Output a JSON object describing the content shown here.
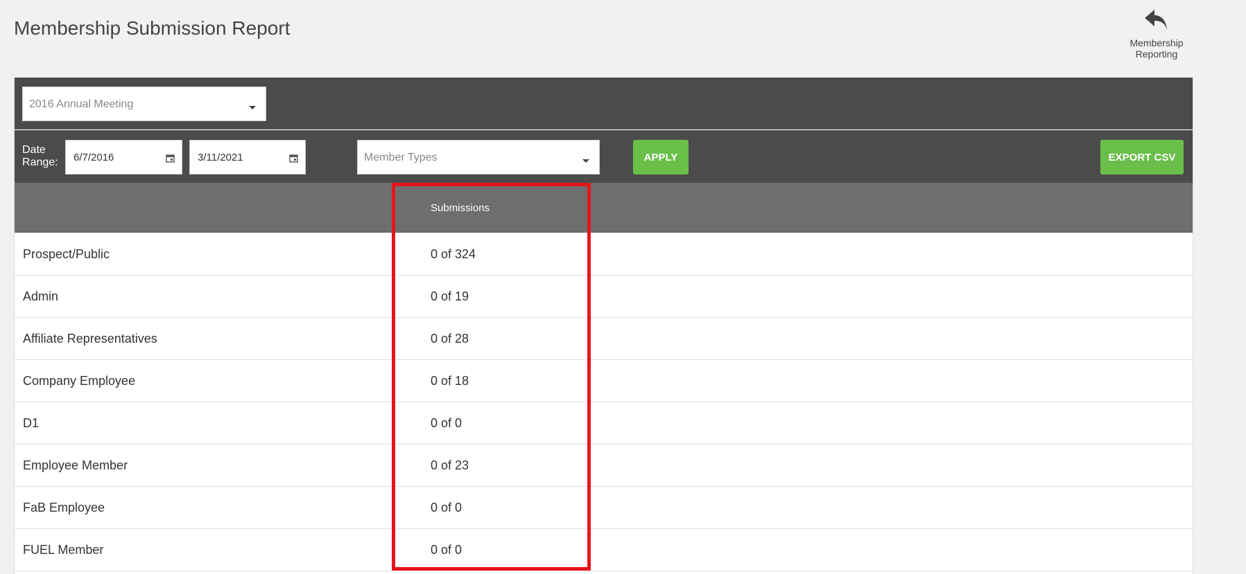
{
  "header": {
    "title": "Membership Submission Report",
    "back_label_line1": "Membership",
    "back_label_line2": "Reporting"
  },
  "filters": {
    "meeting": "2016 Annual Meeting",
    "date_range_label_line1": "Date",
    "date_range_label_line2": "Range:",
    "start_date": "6/7/2016",
    "end_date": "3/11/2021",
    "member_types_placeholder": "Member Types",
    "apply_label": "APPLY",
    "export_label": "EXPORT CSV"
  },
  "table": {
    "columns": [
      "",
      "Submissions"
    ],
    "rows": [
      {
        "type": "Prospect/Public",
        "submissions": "0 of 324"
      },
      {
        "type": "Admin",
        "submissions": "0 of 19"
      },
      {
        "type": "Affiliate Representatives",
        "submissions": "0 of 28"
      },
      {
        "type": "Company Employee",
        "submissions": "0 of 18"
      },
      {
        "type": "D1",
        "submissions": "0 of 0"
      },
      {
        "type": "Employee Member",
        "submissions": "0 of 23"
      },
      {
        "type": "FaB Employee",
        "submissions": "0 of 0"
      },
      {
        "type": "FUEL Member",
        "submissions": "0 of 0"
      }
    ]
  },
  "colors": {
    "toolbar_bg": "#4b4b4b",
    "header_bg": "#6e6e6e",
    "button_green": "#6abf4b",
    "highlight_red": "#e8141b"
  },
  "icons": {
    "back": "reply-arrow-icon",
    "calendar": "calendar-icon",
    "dropdown": "caret-down-icon"
  }
}
